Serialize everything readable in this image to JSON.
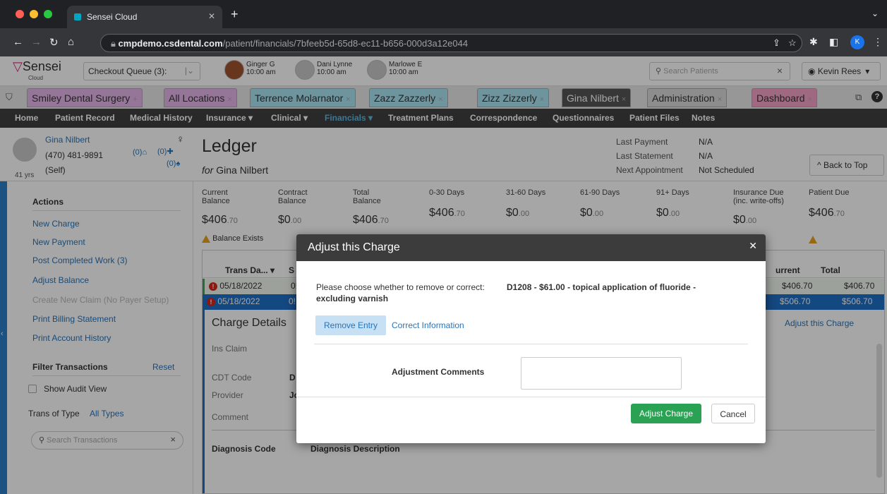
{
  "browser": {
    "tab_title": "Sensei Cloud",
    "url_host": "cmpdemo.csdental.com",
    "url_path": "/patient/financials/7bfeeb5d-65d8-ec11-b656-000d3a12e044",
    "profile_initial": "K"
  },
  "topbar": {
    "logo": "Sensei",
    "logo_sub": "Cloud",
    "queue_label": "Checkout Queue (3):",
    "queue_patients": [
      {
        "name": "Ginger G",
        "time": "10:00 am"
      },
      {
        "name": "Dani Lynne",
        "time": "10:00 am"
      },
      {
        "name": "Marlowe E",
        "time": "10:00 am"
      }
    ],
    "search_placeholder": "Search Patients",
    "user": "Kevin Rees"
  },
  "workspace_tabs": [
    {
      "label": "Smiley Dental Surgery",
      "suffix": "+",
      "color": "#e6b5ea"
    },
    {
      "label": "All Locations",
      "suffix": "×",
      "color": "#e6b5ea"
    },
    {
      "label": "Terrence Molarnator",
      "suffix": "×",
      "color": "#a9e4f3"
    },
    {
      "label": "Zazz Zazzerly",
      "suffix": "×",
      "color": "#a9e4f3"
    },
    {
      "label": "Zizz Zizzerly",
      "suffix": "×",
      "color": "#a9e4f3"
    },
    {
      "label": "Gina Nilbert",
      "suffix": "×",
      "color": "#555555"
    },
    {
      "label": "Administration",
      "suffix": "×",
      "color": "#d9d9d9"
    },
    {
      "label": "Dashboard",
      "suffix": "×",
      "color": "#f5a3c6"
    }
  ],
  "main_nav": [
    "Home",
    "Patient Record",
    "Medical History",
    "Insurance ▾",
    "Clinical ▾",
    "Financials ▾",
    "Treatment Plans",
    "Correspondence",
    "Questionnaires",
    "Patient Files",
    "Notes"
  ],
  "patient": {
    "name": "Gina Nilbert",
    "phone": "(470) 481-9891",
    "age": "41 yrs",
    "relation": "(Self)",
    "count1": "(0)",
    "count2": "(0)",
    "count3": "(0)"
  },
  "ledger": {
    "title": "Ledger",
    "for_label": "for",
    "patient_name": "Gina Nilbert",
    "last_payment_label": "Last Payment",
    "last_payment": "N/A",
    "last_statement_label": "Last Statement",
    "last_statement": "N/A",
    "next_appt_label": "Next Appointment",
    "next_appt": "Not Scheduled",
    "back_to_top": "Back to Top"
  },
  "balances": [
    {
      "label1": "Current",
      "label2": "Balance",
      "dollars": "$406",
      "cents": ".70"
    },
    {
      "label1": "Contract",
      "label2": "Balance",
      "dollars": "$0",
      "cents": ".00"
    },
    {
      "label1": "Total",
      "label2": "Balance",
      "dollars": "$406",
      "cents": ".70"
    },
    {
      "label1": "0-30 Days",
      "label2": "",
      "dollars": "$406",
      "cents": ".70"
    },
    {
      "label1": "31-60 Days",
      "label2": "",
      "dollars": "$0",
      "cents": ".00"
    },
    {
      "label1": "61-90 Days",
      "label2": "",
      "dollars": "$0",
      "cents": ".00"
    },
    {
      "label1": "91+ Days",
      "label2": "",
      "dollars": "$0",
      "cents": ".00"
    },
    {
      "label1": "Insurance Due",
      "label2": "(inc. write-offs)",
      "dollars": "$0",
      "cents": ".00"
    },
    {
      "label1": "Patient Due",
      "label2": "",
      "dollars": "$406",
      "cents": ".70"
    }
  ],
  "balance_exists": "Balance Exists",
  "sidebar": {
    "actions_title": "Actions",
    "actions": [
      "New Charge",
      "New Payment",
      "Post Completed Work (3)",
      "Adjust Balance",
      "Create New Claim (No Payer Setup)",
      "Print Billing Statement",
      "Print Account History"
    ],
    "filter_title": "Filter Transactions",
    "reset": "Reset",
    "show_audit": "Show Audit View",
    "trans_type_label": "Trans of Type",
    "trans_type_value": "All Types",
    "search_placeholder": "Search Transactions"
  },
  "table": {
    "col_trans_date": "Trans Da...",
    "col_current": "urrent",
    "col_total": "Total",
    "rows": [
      {
        "date": "05/18/2022",
        "current": "$406.70",
        "total": "$406.70"
      },
      {
        "date": "05/18/2022",
        "current": "$506.70",
        "total": "$506.70"
      }
    ],
    "adjust_link": "Adjust this Charge"
  },
  "charge_details": {
    "title": "Charge Details",
    "ins_claim": "Ins Claim",
    "cdt_code": "CDT Code",
    "cdt_value": "D",
    "provider": "Provider",
    "provider_value": "Jc",
    "comment": "Comment",
    "diag_code": "Diagnosis Code",
    "diag_desc": "Diagnosis Description"
  },
  "modal": {
    "title": "Adjust this Charge",
    "prompt": "Please choose whether to remove or correct:",
    "charge_line1": "D1208 - $61.00 - topical application of fluoride -",
    "charge_line2": "excluding varnish",
    "tab_remove": "Remove Entry",
    "tab_correct": "Correct Information",
    "comments_label": "Adjustment Comments",
    "comments_value": "",
    "submit": "Adjust Charge",
    "cancel": "Cancel"
  }
}
